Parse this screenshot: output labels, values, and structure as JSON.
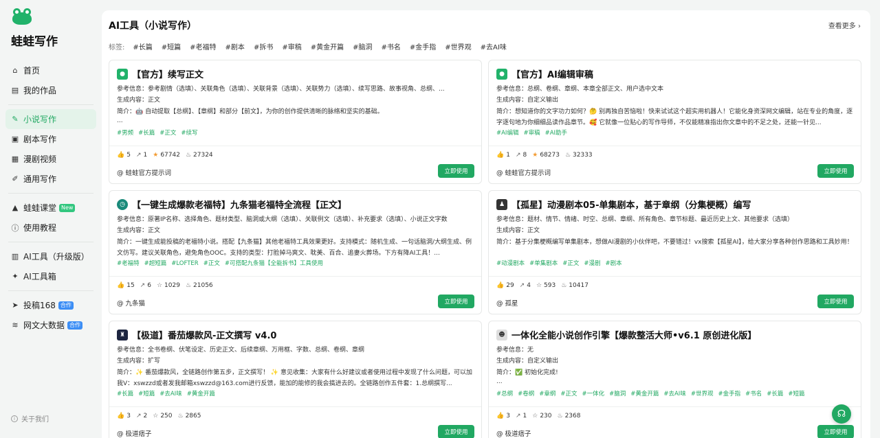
{
  "brand": {
    "name": "蛙蛙写作"
  },
  "nav": {
    "home": "首页",
    "works": "我的作品",
    "novel": "小说写作",
    "script": "剧本写作",
    "comic": "漫剧视频",
    "general": "通用写作",
    "class": "蛙蛙课堂",
    "class_badge": "New",
    "tutorial": "使用教程",
    "ai_upgrade": "AI工具（升级版）",
    "ai_box": "AI工具箱",
    "submit": "投稿168",
    "submit_badge": "合作",
    "bigdata": "网文大数据",
    "bigdata_badge": "合作",
    "about": "关于我们"
  },
  "main": {
    "title": "AI工具（小说写作）",
    "more": "查看更多 ›",
    "tags_label": "标签:",
    "tags": [
      "#长篇",
      "#短篇",
      "#老福特",
      "#剧本",
      "#拆书",
      "#审稿",
      "#黄金开篇",
      "#脑洞",
      "#书名",
      "#金手指",
      "#世界观",
      "#去AI味"
    ]
  },
  "accent_color": "#21a862",
  "cards": [
    {
      "title": "【官方】续写正文",
      "ref": "参考信息：参考剧情（选填）、关联角色（选填）、关联背景（选填）、关联势力（选填）、续写思路、故事视角、总纲、...",
      "gen": "生成内容：正文",
      "intro": "简介：🤖 自动提取【总纲】、【章纲】和部分【前文】，为你的创作提供清晰的脉络和坚实的基础。",
      "dots": "...",
      "tags": [
        "#男频",
        "#长篇",
        "#正文",
        "#续写"
      ],
      "likes": "5",
      "shares": "1",
      "stars": "67742",
      "uses": "27324",
      "author": "@ 蛙蛙官方提示词",
      "button": "立即使用"
    },
    {
      "title": "【官方】AI编辑审稿",
      "ref": "参考信息：总纲、卷纲、章纲、本章全部正文、用户选中文本",
      "gen": "生成内容：自定义输出",
      "intro": "简介：想知道你的文字功力如何？🤔 别再独自苦恼啦！快来试试这个超实用机器人！它能化身资深网文编辑，站在专业的角度，逐字逐句地为你细细品读作品章节。🥰 它就像一位贴心的写作导师，不仅能精准指出你文章中的不足之处，还能一针见...",
      "dots": "",
      "tags": [
        "#AI编辑",
        "#审稿",
        "#AI助手"
      ],
      "likes": "1",
      "shares": "8",
      "stars": "68273",
      "uses": "32333",
      "author": "@ 蛙蛙官方提示词",
      "button": "立即使用"
    },
    {
      "title": "【一键生成爆款老福特】九条猫老福特全流程【正文】",
      "ref": "参考信息：原著IP名称、选择角色、题材类型、脑洞或大纲（选填）、关联例文（选填）、补充要求（选填）、小说正文字数",
      "gen": "生成内容：正文",
      "intro": "简介：一键生成能投稿的老福特小说。搭配【九条猫】其他老福特工具效果更好。支持模式：随机生成、一句话脑洞/大纲生成、例文仿写。建议关联角色，避免角色OOC。支持的类型：打脸掉马爽文、耽美、百合、追妻火葬场。下方有降AI工具！...",
      "dots": "",
      "tags": [
        "#老福特",
        "#超短篇",
        "#LOFTER",
        "#正文",
        "#可搭配九条猫【全能拆书】工具使用"
      ],
      "likes": "15",
      "shares": "6",
      "stars": "1029",
      "uses": "21056",
      "author": "@ 九条猫",
      "button": "立即使用"
    },
    {
      "title": "【孤星】动漫剧本05-单集剧本，基于章纲（分集梗概）编写",
      "ref": "参考信息：题材、情节、情绪、时空、总纲、章纲、所有角色、章节标题、最近历史上文、其他要求（选填）",
      "gen": "生成内容：正文",
      "intro": "简介：基于分集梗概编写单集剧本，想做AI漫剧的小伙伴吧，不要错过！vx搜索【孤星AI】，给大家分享各种创作思路和工具妙用！",
      "dots": "",
      "tags": [
        "#动漫剧本",
        "#单集剧本",
        "#正文",
        "#漫剧",
        "#剧本"
      ],
      "likes": "29",
      "shares": "4",
      "stars": "593",
      "uses": "10417",
      "author": "@ 孤星",
      "button": "立即使用"
    },
    {
      "title": "【极道】番茄爆款风-正文撰写 v4.0",
      "ref": "参考信息：全书卷纲、伏笔设定、历史正文、后续章纲、万用框、字数、总纲、卷纲、章纲",
      "gen": "生成内容：扩写",
      "intro": "简介：✨ 番茄爆款风，全链路创作第五步，正文撰写！ ✨ 意见收集：大家有什么好建议或者使用过程中发现了什么问题，可以加我V：xswzzd或者发我邮箱xswzzd@163.com进行反馈，能加的能修的我会搞进去的。全链路创作五件套：1.总纲撰写...",
      "dots": "",
      "tags": [
        "#长篇",
        "#短篇",
        "#去AI味",
        "#黄金开篇"
      ],
      "likes": "3",
      "shares": "2",
      "stars": "250",
      "uses": "2865",
      "author": "@ 极道痞子",
      "button": "立即使用"
    },
    {
      "title": "一体化全能小说创作引擎【爆款整活大师•v6.1 原创进化版】",
      "ref": "参考信息：无",
      "gen": "生成内容：自定义输出",
      "intro": "简介：✅ 初始化完成!",
      "dots": "...",
      "tags": [
        "#总纲",
        "#卷纲",
        "#章纲",
        "#正文",
        "#一体化",
        "#脑洞",
        "#黄金开篇",
        "#去AI味",
        "#世界观",
        "#金手指",
        "#书名",
        "#长篇",
        "#短篇"
      ],
      "likes": "3",
      "shares": "1",
      "stars": "230",
      "uses": "2368",
      "author": "@ 极道痞子",
      "button": "立即使用"
    }
  ]
}
